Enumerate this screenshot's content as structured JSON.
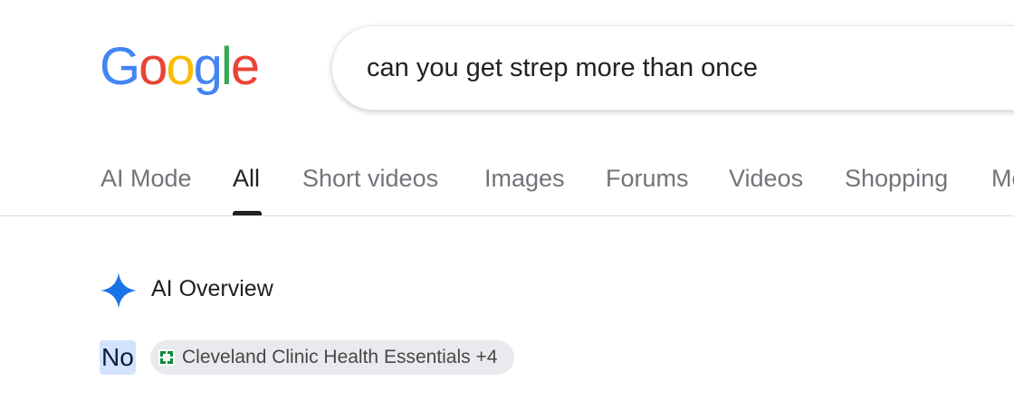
{
  "logo": {
    "letters": [
      "G",
      "o",
      "o",
      "g",
      "l",
      "e"
    ],
    "colors": [
      "#4285F4",
      "#EA4335",
      "#FBBC05",
      "#4285F4",
      "#34A853",
      "#EA4335"
    ]
  },
  "search": {
    "query": "can you get strep more than once"
  },
  "tabs": [
    {
      "label": "AI Mode",
      "active": false
    },
    {
      "label": "All",
      "active": true
    },
    {
      "label": "Short videos",
      "active": false
    },
    {
      "label": "Images",
      "active": false
    },
    {
      "label": "Forums",
      "active": false
    },
    {
      "label": "Videos",
      "active": false
    },
    {
      "label": "Shopping",
      "active": false
    },
    {
      "label": "More",
      "active": false
    }
  ],
  "ai_overview": {
    "title": "AI Overview",
    "icon": "sparkle-icon",
    "icon_color": "#1a73e8",
    "answer": "No",
    "source": {
      "label": "Cleveland Clinic Health Essentials +4",
      "icon": "cleveland-clinic-favicon",
      "icon_color": "#0d8a3e"
    }
  }
}
